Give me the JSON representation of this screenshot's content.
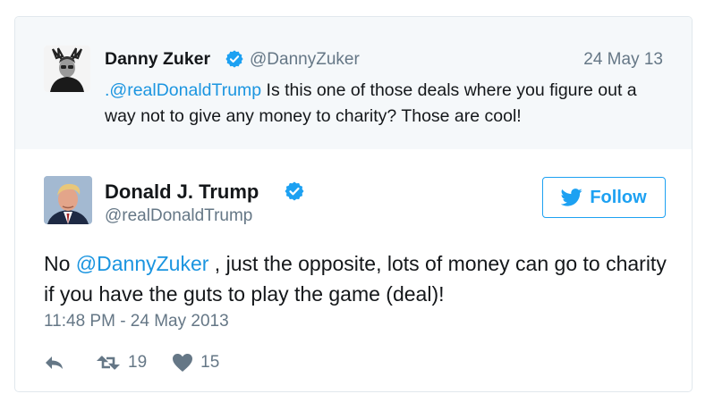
{
  "parent_tweet": {
    "display_name": "Danny Zuker",
    "handle": "@DannyZuker",
    "date": "24 May 13",
    "mention": ".@realDonaldTrump",
    "text_after_mention": " Is this one of those deals where you figure out a way not to give any money to charity? Those are cool!",
    "verified": true
  },
  "tweet": {
    "display_name": "Donald J. Trump",
    "handle": "@realDonaldTrump",
    "verified": true,
    "text_prefix": "No ",
    "mention": "@DannyZuker",
    "text_suffix": " , just the opposite, lots of money can go to charity if you have the guts to play the game (deal)!",
    "timestamp": "11:48 PM - 24 May 2013",
    "retweet_count": "19",
    "like_count": "15"
  },
  "follow_button": {
    "label": "Follow",
    "icon": "twitter-bird-icon"
  },
  "colors": {
    "link": "#1b95e0",
    "brand": "#1da1f2",
    "muted": "#657786",
    "parent_background": "#f5f8fa"
  }
}
